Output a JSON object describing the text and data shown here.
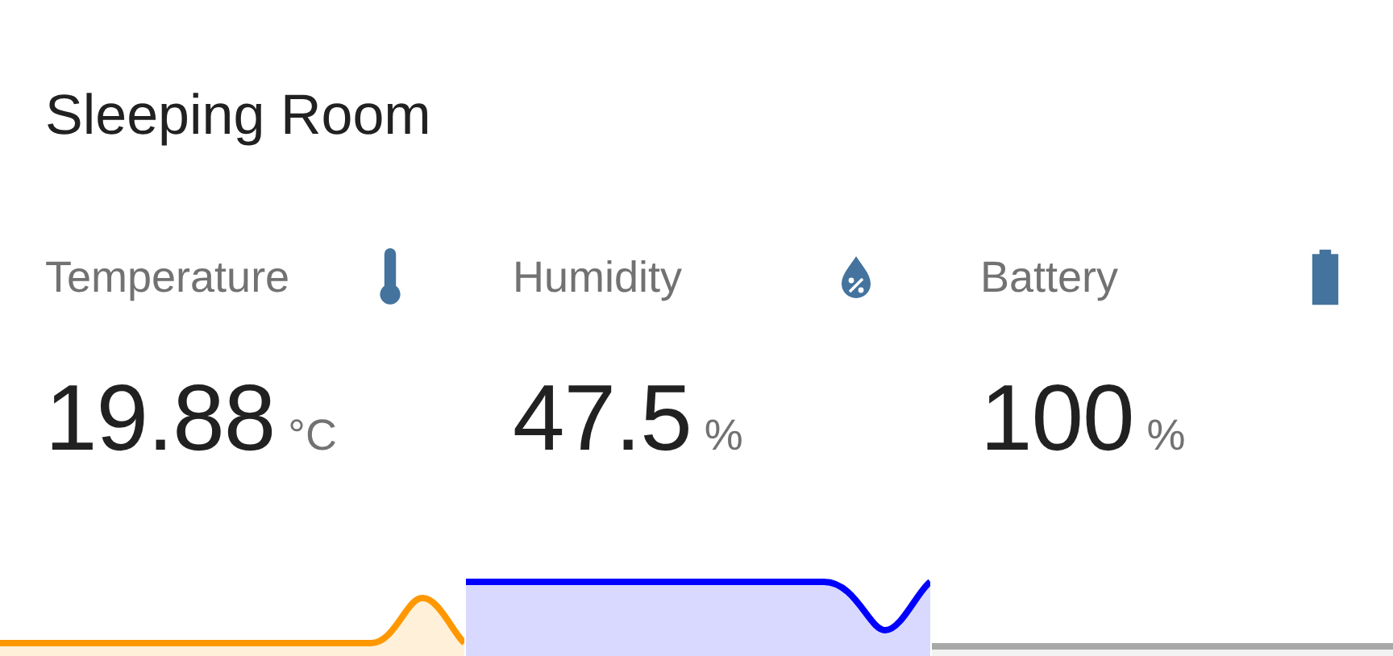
{
  "title": "Sleeping Room",
  "sensors": [
    {
      "label": "Temperature",
      "value": "19.88",
      "unit": "°C"
    },
    {
      "label": "Humidity",
      "value": "47.5",
      "unit": "%"
    },
    {
      "label": "Battery",
      "value": "100",
      "unit": "%"
    }
  ]
}
